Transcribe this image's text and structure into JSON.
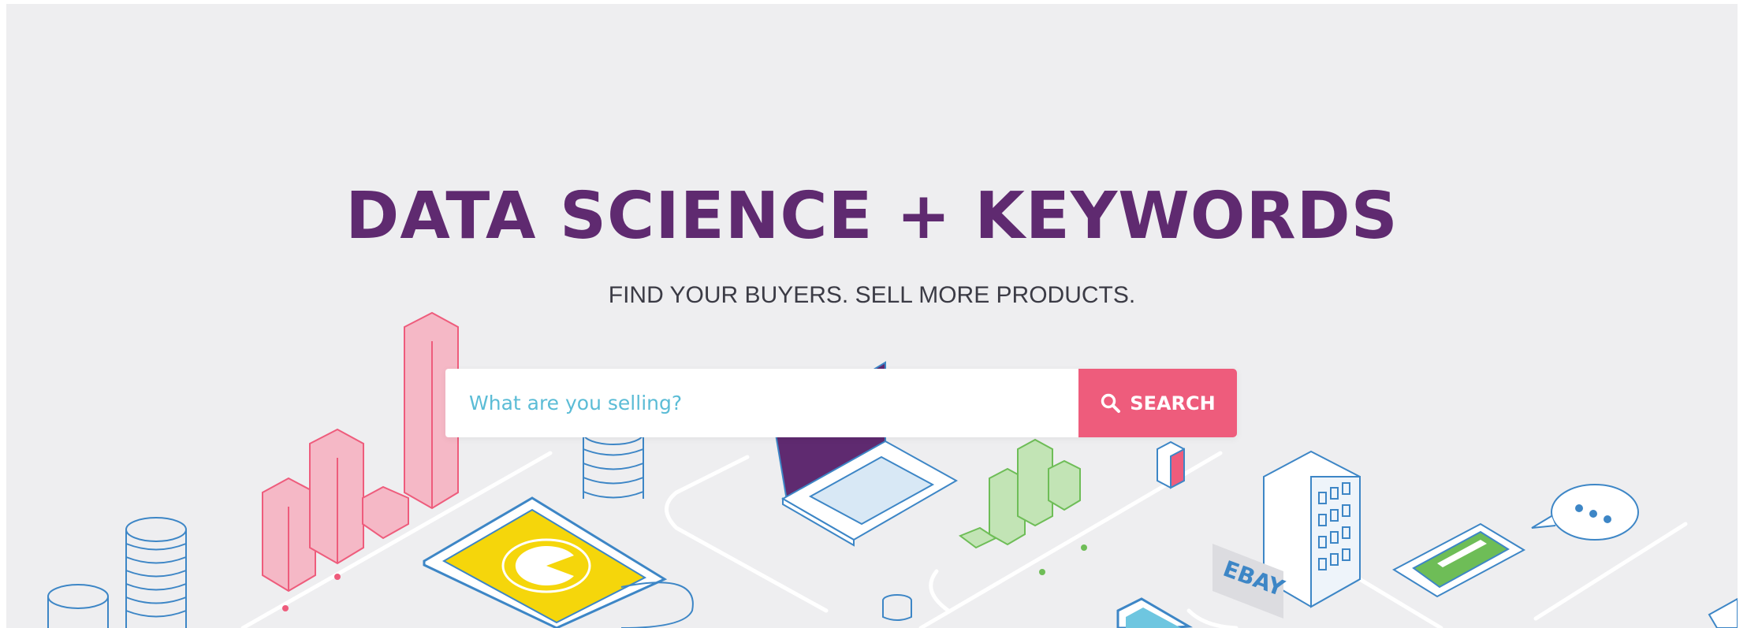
{
  "hero": {
    "headline": "DATA SCIENCE + KEYWORDS",
    "subheadline": "FIND YOUR BUYERS. SELL MORE PRODUCTS.",
    "background_color": "#eeeef0",
    "headline_color": "#5f2a70"
  },
  "search": {
    "placeholder": "What are you selling?",
    "value": "",
    "button_label": "SEARCH",
    "button_icon": "search-icon",
    "button_color": "#ee5c7c",
    "placeholder_color": "#5bbcd6"
  },
  "illustration": {
    "building_sign": "EBAY",
    "colors": {
      "pink": "#ee5c7c",
      "blue": "#3d86c6",
      "green": "#6ebd57",
      "yellow": "#f5d60b",
      "purple": "#5f2a70"
    }
  }
}
